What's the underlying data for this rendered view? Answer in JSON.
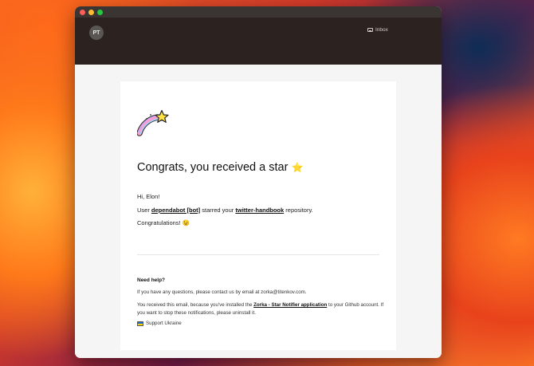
{
  "header": {
    "avatar_initials": "PT",
    "inbox_label": "Inbox"
  },
  "email": {
    "headline": "Congrats, you received a star",
    "headline_emoji": "⭐",
    "greeting": "Hi, Elon!",
    "star_line": {
      "prefix": "User ",
      "user": "dependabot [bot]",
      "middle": " starred your ",
      "repo": "twitter-handbook",
      "suffix": " repository."
    },
    "congrats": "Congratulations!",
    "congrats_emoji": "😉",
    "help_title": "Need help?",
    "help_text": "If you have any questions, please contact us by email at zorka@titenkov.com.",
    "reason": {
      "prefix": "You received this email, because you've installed the ",
      "app": "Zorka - Star Notifier application",
      "suffix": " to your Github account. If you want to stop these notifications, please uninstall it."
    },
    "support": "Support Ukraine"
  },
  "icons": {
    "emblem": "shooting-star-rainbow-icon",
    "inbox": "inbox-icon",
    "flag": "ukraine-flag-icon"
  },
  "colors": {
    "header_bg": "#2c221f",
    "titlebar_bg": "#3a3533",
    "traffic_red": "#ff5f57",
    "traffic_yellow": "#febc2e",
    "traffic_green": "#28c840"
  }
}
